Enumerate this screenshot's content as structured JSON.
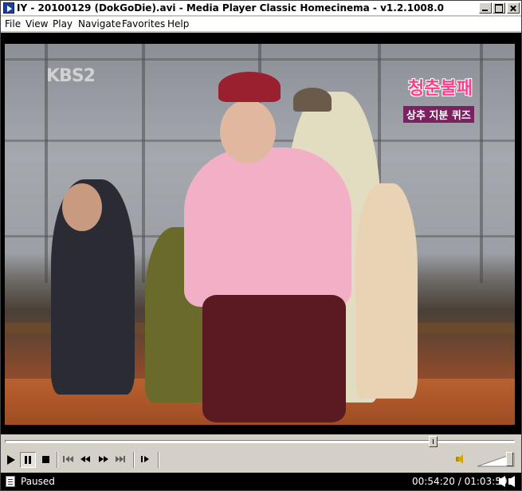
{
  "window": {
    "title": "IY - 20100129 (DokGoDie).avi - Media Player Classic Homecinema - v1.2.1008.0"
  },
  "menu": {
    "items": [
      "File",
      "View",
      "Play",
      "Navigate",
      "Favorites",
      "Help"
    ]
  },
  "video": {
    "channel_logo": "KBS2",
    "show_title": "청춘불패",
    "show_subtitle": "상추 지분 퀴즈"
  },
  "seek": {
    "position_fraction": 0.846
  },
  "toolbar": {
    "buttons": [
      {
        "name": "play-button",
        "icon": "play-icon"
      },
      {
        "name": "pause-button",
        "icon": "pause-icon",
        "pressed": true
      },
      {
        "name": "stop-button",
        "icon": "stop-icon"
      },
      {
        "name": "previous-button",
        "icon": "skip-back-icon"
      },
      {
        "name": "rewind-button",
        "icon": "rewind-icon"
      },
      {
        "name": "fast-forward-button",
        "icon": "fast-forward-icon"
      },
      {
        "name": "next-button",
        "icon": "skip-forward-icon"
      },
      {
        "name": "frame-step-button",
        "icon": "frame-step-icon"
      }
    ],
    "volume_fraction": 0.95,
    "volume_icon": "speaker-icon"
  },
  "status": {
    "state": "Paused",
    "time": "00:54:20 / 01:03:59",
    "colors": {
      "status_bg": "#000000",
      "status_fg": "#ffffff"
    }
  }
}
